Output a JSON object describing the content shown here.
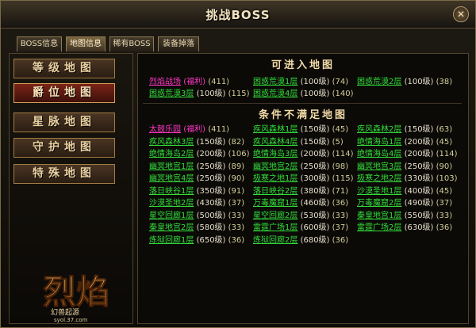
{
  "window": {
    "title": "挑战BOSS",
    "close_label": "✕"
  },
  "tabs": [
    {
      "label": "BOSS信息",
      "active": false
    },
    {
      "label": "地图信息",
      "active": true
    },
    {
      "label": "稀有BOSS",
      "active": false
    },
    {
      "label": "装备掉落",
      "active": false
    }
  ],
  "categories": [
    {
      "label": "等级地图",
      "active": false
    },
    {
      "label": "爵位地图",
      "active": true
    },
    {
      "label": "星脉地图",
      "active": false
    },
    {
      "label": "守护地图",
      "active": false
    },
    {
      "label": "特殊地图",
      "active": false
    }
  ],
  "logo": {
    "name": "烈焰",
    "subtitle": "幻兽起源",
    "url": "syol.37.com"
  },
  "available": {
    "title": "可进入地图",
    "maps": [
      {
        "name": "烈焰战场",
        "tag": "(福利)",
        "level": "",
        "count": "(411)",
        "special": true
      },
      {
        "name": "困惑荒漠1层",
        "tag": "",
        "level": "(100级)",
        "count": "(74)",
        "special": false
      },
      {
        "name": "困惑荒漠2层",
        "tag": "",
        "level": "(100级)",
        "count": "(38)",
        "special": false
      },
      {
        "name": "困惑荒漠3层",
        "tag": "",
        "level": "(100级)",
        "count": "(115)",
        "special": false
      },
      {
        "name": "困惑荒漠4层",
        "tag": "",
        "level": "(100级)",
        "count": "(140)",
        "special": false
      }
    ]
  },
  "unavailable": {
    "title": "条件不满足地图",
    "maps": [
      {
        "name": "太鼓乐园",
        "tag": "(福利)",
        "level": "",
        "count": "(411)",
        "special": true
      },
      {
        "name": "疾风森林1层",
        "tag": "",
        "level": "(150级)",
        "count": "(45)",
        "special": false
      },
      {
        "name": "疾风森林2层",
        "tag": "",
        "level": "(150级)",
        "count": "(63)",
        "special": false
      },
      {
        "name": "疾风森林3层",
        "tag": "",
        "level": "(150级)",
        "count": "(82)",
        "special": false
      },
      {
        "name": "疾风森林4层",
        "tag": "",
        "level": "(150级)",
        "count": "(5)",
        "special": false
      },
      {
        "name": "绝情海岛1层",
        "tag": "",
        "level": "(200级)",
        "count": "(45)",
        "special": false
      },
      {
        "name": "绝情海岛2层",
        "tag": "",
        "level": "(200级)",
        "count": "(106)",
        "special": false
      },
      {
        "name": "绝情海岛3层",
        "tag": "",
        "level": "(200级)",
        "count": "(114)",
        "special": false
      },
      {
        "name": "绝情海岛4层",
        "tag": "",
        "level": "(200级)",
        "count": "(114)",
        "special": false
      },
      {
        "name": "幽冥地宫1层",
        "tag": "",
        "level": "(250级)",
        "count": "(89)",
        "special": false
      },
      {
        "name": "幽冥地宫2层",
        "tag": "",
        "level": "(250级)",
        "count": "(98)",
        "special": false
      },
      {
        "name": "幽冥地宫3层",
        "tag": "",
        "level": "(250级)",
        "count": "(90)",
        "special": false
      },
      {
        "name": "幽冥地宫4层",
        "tag": "",
        "level": "(250级)",
        "count": "(90)",
        "special": false
      },
      {
        "name": "极寒之地1层",
        "tag": "",
        "level": "(300级)",
        "count": "(115)",
        "special": false
      },
      {
        "name": "极寒之地2层",
        "tag": "",
        "level": "(330级)",
        "count": "(103)",
        "special": false
      },
      {
        "name": "落日峡谷1层",
        "tag": "",
        "level": "(350级)",
        "count": "(91)",
        "special": false
      },
      {
        "name": "落日峡谷2层",
        "tag": "",
        "level": "(380级)",
        "count": "(71)",
        "special": false
      },
      {
        "name": "沙漠圣地1层",
        "tag": "",
        "level": "(400级)",
        "count": "(45)",
        "special": false
      },
      {
        "name": "沙漠圣地2层",
        "tag": "",
        "level": "(430级)",
        "count": "(37)",
        "special": false
      },
      {
        "name": "万毒魔窟1层",
        "tag": "",
        "level": "(460级)",
        "count": "(36)",
        "special": false
      },
      {
        "name": "万毒魔窟2层",
        "tag": "",
        "level": "(490级)",
        "count": "(37)",
        "special": false
      },
      {
        "name": "星空回廊1层",
        "tag": "",
        "level": "(500级)",
        "count": "(33)",
        "special": false
      },
      {
        "name": "星空回廊2层",
        "tag": "",
        "level": "(530级)",
        "count": "(33)",
        "special": false
      },
      {
        "name": "秦皇地宫1层",
        "tag": "",
        "level": "(550级)",
        "count": "(33)",
        "special": false
      },
      {
        "name": "秦皇地宫2层",
        "tag": "",
        "level": "(580级)",
        "count": "(33)",
        "special": false
      },
      {
        "name": "雷霆广场1层",
        "tag": "",
        "level": "(600级)",
        "count": "(37)",
        "special": false
      },
      {
        "name": "雷霆广场2层",
        "tag": "",
        "level": "(630级)",
        "count": "(36)",
        "special": false
      },
      {
        "name": "炼狱回廊1层",
        "tag": "",
        "level": "(650级)",
        "count": "(36)",
        "special": false
      },
      {
        "name": "炼狱回廊2层",
        "tag": "",
        "level": "(680级)",
        "count": "(36)",
        "special": false
      }
    ]
  },
  "colors": {
    "map_available": "#33dd3a",
    "map_special": "#ff37c6",
    "title_gold": "#f2dba8",
    "button_active": "#7a2417"
  }
}
